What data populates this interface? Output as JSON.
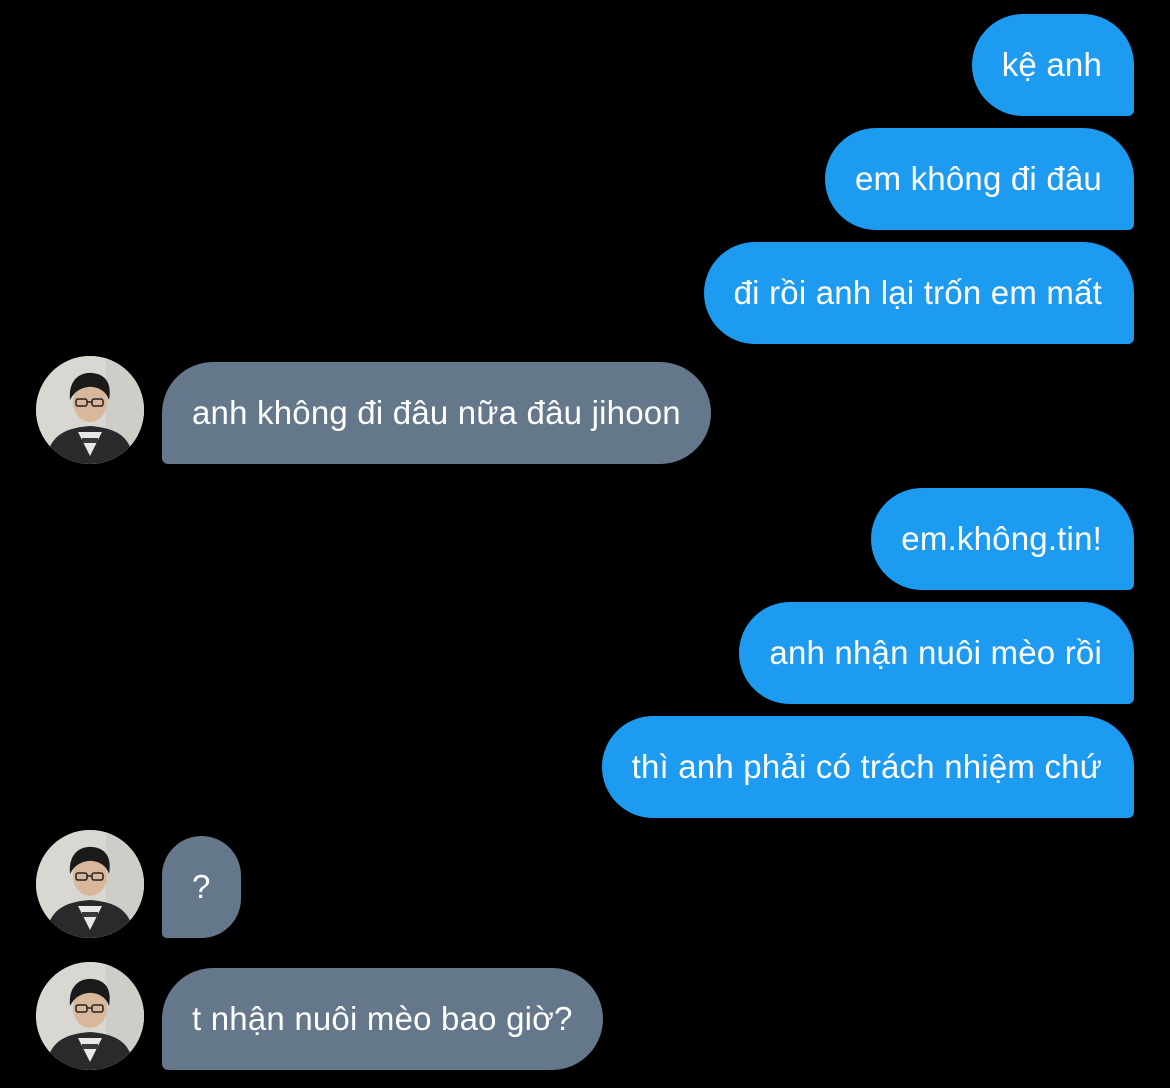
{
  "conversation": {
    "messages": [
      {
        "sender": "me",
        "text": "kệ anh"
      },
      {
        "sender": "me",
        "text": "em không đi đâu"
      },
      {
        "sender": "me",
        "text": "đi rồi anh lại trốn em mất"
      },
      {
        "sender": "other",
        "text": "anh không đi đâu nữa đâu jihoon"
      },
      {
        "sender": "me",
        "text": "em.không.tin!"
      },
      {
        "sender": "me",
        "text": "anh nhận nuôi mèo rồi"
      },
      {
        "sender": "me",
        "text": "thì anh phải có trách nhiệm chứ"
      },
      {
        "sender": "other",
        "text": "?"
      },
      {
        "sender": "other",
        "text": "t nhận nuôi mèo bao giờ?"
      }
    ]
  },
  "colors": {
    "background": "#000000",
    "sent_bubble": "#1d9bf0",
    "received_bubble": "#65778a",
    "text": "#ffffff"
  },
  "icons": {
    "avatar": "avatar-photo"
  }
}
